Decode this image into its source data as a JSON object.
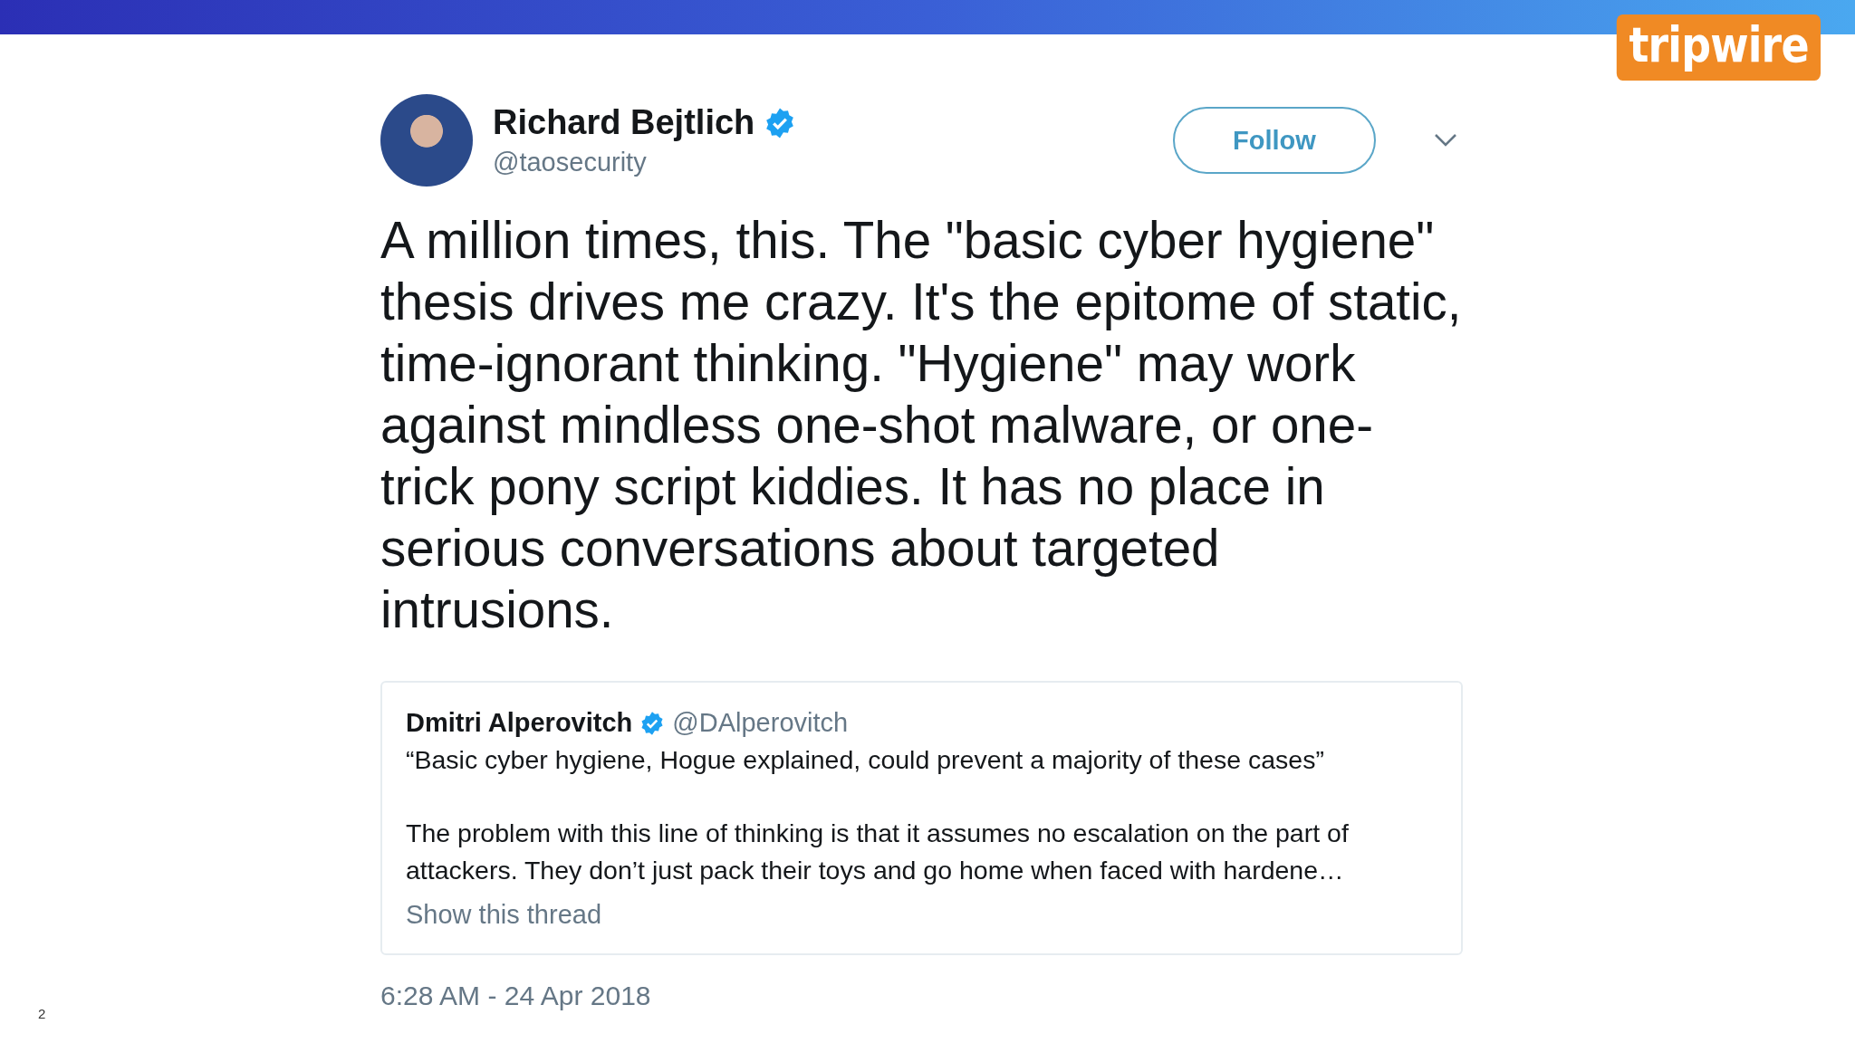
{
  "logo": {
    "text": "tripwire"
  },
  "tweet": {
    "author": {
      "name": "Richard Bejtlich",
      "handle": "@taosecurity",
      "verified": true
    },
    "follow_button": "Follow",
    "text": "A million times, this. The \"basic cyber hygiene\" thesis drives me crazy. It's the epitome of static, time-ignorant thinking. \"Hygiene\" may work against mindless one-shot malware, or one-trick pony script kiddies. It has no place in serious conversations about targeted intrusions.",
    "quoted_tweet": {
      "name": "Dmitri Alperovitch",
      "handle": "@DAlperovitch",
      "verified": true,
      "paragraphs": [
        "“Basic cyber hygiene, Hogue explained, could prevent a majority of these cases”",
        "The problem with this line of thinking is that it assumes no escalation on the part of attackers. They don’t just pack their toys and go home when faced with hardene…"
      ],
      "show_thread": "Show this thread"
    },
    "timestamp": "6:28 AM - 24 Apr 2018"
  },
  "slide_number": "2"
}
